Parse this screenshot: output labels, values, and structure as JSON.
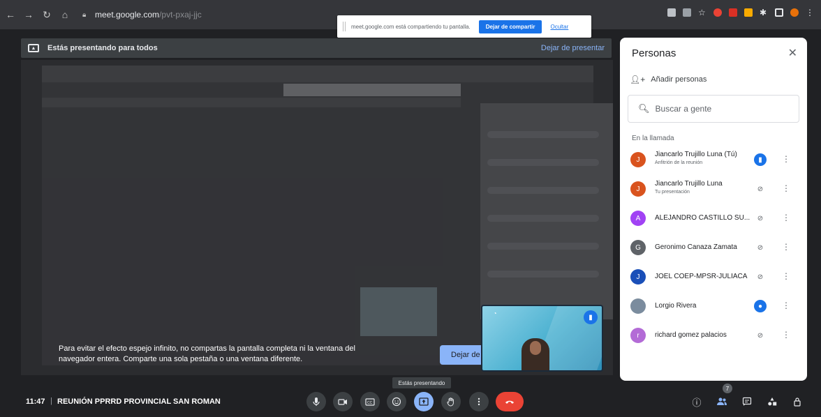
{
  "browser": {
    "url_host": "meet.google.com",
    "url_path": "/pvt-pxaj-jjc"
  },
  "share_notice": {
    "text": "meet.google.com está compartiendo tu pantalla.",
    "stop_label": "Dejar de compartir",
    "hide_label": "Ocultar"
  },
  "presenting_banner": {
    "text": "Estás presentando para todos",
    "stop_label": "Dejar de presentar"
  },
  "stage": {
    "warning": "Para evitar el efecto espejo infinito, no compartas la pantalla completa ni la ventana del navegador entera. Comparte una sola pestaña o una ventana diferente.",
    "stop_button": "Dejar de",
    "tooltip": "Estás presentando"
  },
  "meeting": {
    "time": "11:47",
    "separator": "|",
    "title": "REUNIÓN PPRRD PROVINCIAL SAN ROMAN",
    "participant_count": "7"
  },
  "controls": {
    "mic": "microphone-icon",
    "camera": "camera-icon",
    "captions": "captions-icon",
    "emoji": "emoji-icon",
    "present": "present-icon",
    "hand": "raise-hand-icon",
    "more": "more-options-icon",
    "end": "end-call-icon"
  },
  "people_panel": {
    "title": "Personas",
    "add_label": "Añadir personas",
    "search_placeholder": "Buscar a gente",
    "section_label": "En la llamada",
    "participants": [
      {
        "initial": "J",
        "name": "Jiancarlo Trujillo Luna (Tú)",
        "sub": "Anfitrión de la reunión",
        "color": "#e8710a",
        "mic": "speaking"
      },
      {
        "initial": "J",
        "name": "Jiancarlo Trujillo Luna",
        "sub": "Tu presentación",
        "color": "#e8710a",
        "mic": "muted"
      },
      {
        "initial": "A",
        "name": "ALEJANDRO CASTILLO SU...",
        "sub": "",
        "color": "#a142f4",
        "mic": "muted"
      },
      {
        "initial": "G",
        "name": "Geronimo Canaza Zamata",
        "sub": "",
        "color": "#5f6368",
        "mic": "muted"
      },
      {
        "initial": "J",
        "name": "JOEL COEP-MPSR-JULIACA",
        "sub": "",
        "color": "#1a73e8",
        "mic": "muted"
      },
      {
        "initial": "",
        "name": "Lorgio Rivera",
        "sub": "",
        "color": "#7b8c9e",
        "mic": "speaking"
      },
      {
        "initial": "r",
        "name": "richard gomez palacios",
        "sub": "",
        "color": "#a142f4",
        "mic": "muted"
      }
    ]
  },
  "colors": {
    "accent": "#8ab4f8",
    "primary_blue": "#1a73e8",
    "end_call_red": "#ea4335",
    "bg_dark": "#202124"
  }
}
